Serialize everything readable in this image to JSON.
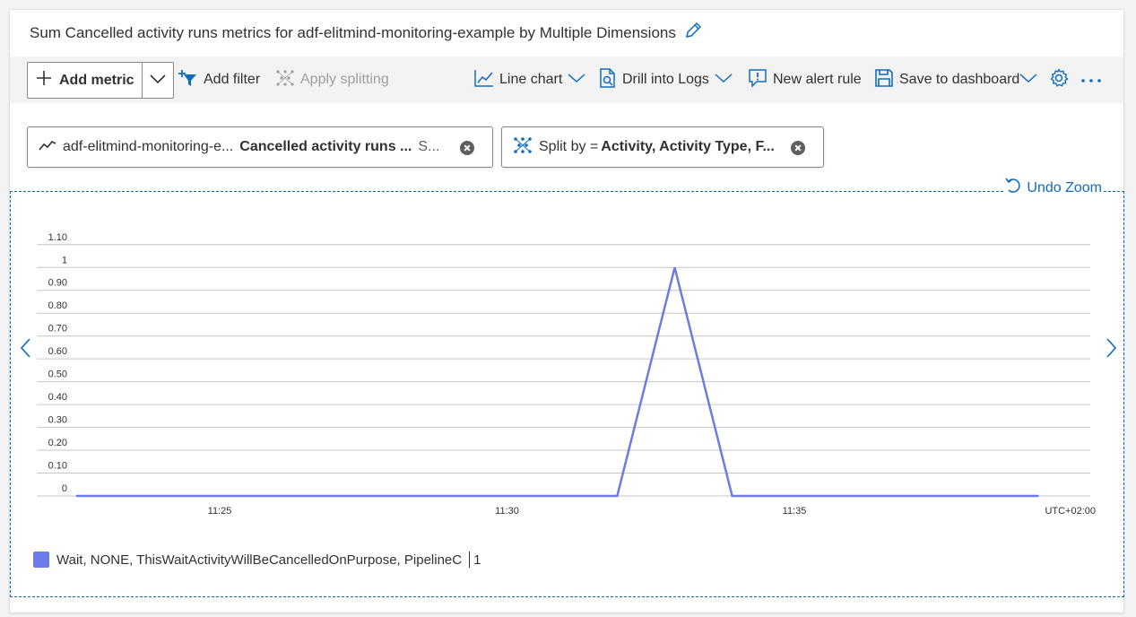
{
  "title": "Sum Cancelled activity runs metrics for adf-elitmind-monitoring-example by Multiple Dimensions",
  "toolbar": {
    "add_metric": "Add metric",
    "add_filter": "Add filter",
    "apply_splitting": "Apply splitting",
    "line_chart": "Line chart",
    "drill_into_logs": "Drill into Logs",
    "new_alert_rule": "New alert rule",
    "save_to_dashboard": "Save to dashboard"
  },
  "pills": {
    "metric": {
      "resource": "adf-elitmind-monitoring-e...",
      "metric": "Cancelled activity runs ...",
      "aggregation": "S..."
    },
    "split": {
      "prefix": "Split by =",
      "value": "Activity, Activity Type, F..."
    }
  },
  "undo_zoom": "Undo Zoom",
  "colors": {
    "accent": "#0f6cbd",
    "series": "#6b7be8"
  },
  "chart_data": {
    "type": "line",
    "ylim": [
      0,
      1.1
    ],
    "y_tick_labels": [
      "0",
      "0.10",
      "0.20",
      "0.30",
      "0.40",
      "0.50",
      "0.60",
      "0.70",
      "0.80",
      "0.90",
      "1",
      "1.10"
    ],
    "x_tick_labels": [
      "11:25",
      "11:30",
      "11:35"
    ],
    "timezone_label": "UTC+02:00",
    "grid": true,
    "legend_position": "bottom-left",
    "series": [
      {
        "name": "Wait, NONE, ThisWaitActivityWillBeCancelledOnPurpose, PipelineC",
        "x": [
          "11:22:30",
          "11:31:55",
          "11:32:55",
          "11:33:55",
          "11:39:15"
        ],
        "y": [
          0,
          0,
          1,
          0,
          0
        ]
      }
    ],
    "legend_value": "1"
  }
}
